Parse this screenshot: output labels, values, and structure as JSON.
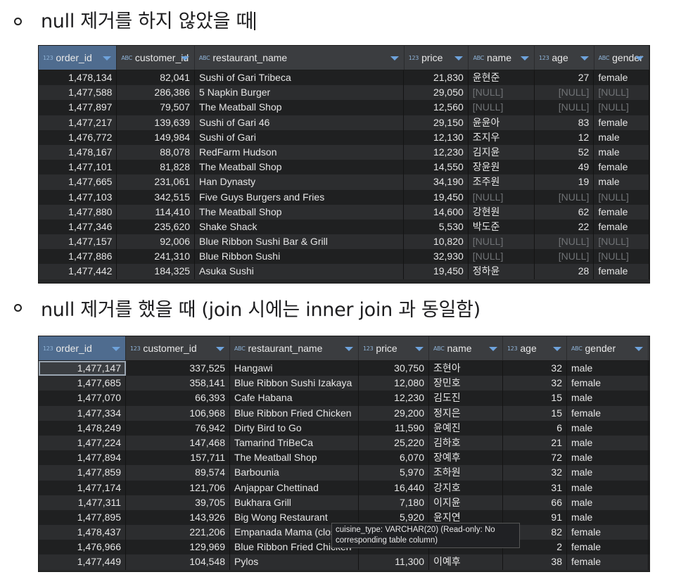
{
  "section1": {
    "text": "null 제거를 하지 않았을 때"
  },
  "section2": {
    "text": "null 제거를 했을 때 (join 시에는 inner join 과 동일함)"
  },
  "table1": {
    "columns": [
      {
        "type": "123",
        "label": "order_id"
      },
      {
        "type": "ABC",
        "label": "customer_id"
      },
      {
        "type": "ABC",
        "label": "restaurant_name"
      },
      {
        "type": "123",
        "label": "price"
      },
      {
        "type": "ABC",
        "label": "name"
      },
      {
        "type": "123",
        "label": "age"
      },
      {
        "type": "ABC",
        "label": "gender"
      }
    ],
    "rows": [
      [
        "1,478,134",
        "82,041",
        "Sushi of Gari Tribeca",
        "21,830",
        "윤현준",
        "27",
        "female"
      ],
      [
        "1,477,588",
        "286,386",
        "5 Napkin Burger",
        "29,050",
        "[NULL]",
        "[NULL]",
        "[NULL]"
      ],
      [
        "1,477,897",
        "79,507",
        "The Meatball Shop",
        "12,560",
        "[NULL]",
        "[NULL]",
        "[NULL]"
      ],
      [
        "1,477,217",
        "139,639",
        "Sushi of Gari 46",
        "29,150",
        "윤윤아",
        "83",
        "female"
      ],
      [
        "1,476,772",
        "149,984",
        "Sushi of Gari",
        "12,130",
        "조지우",
        "12",
        "male"
      ],
      [
        "1,478,167",
        "88,078",
        "RedFarm Hudson",
        "12,230",
        "김지윤",
        "52",
        "male"
      ],
      [
        "1,477,101",
        "81,828",
        "The Meatball Shop",
        "14,550",
        "장윤원",
        "49",
        "female"
      ],
      [
        "1,477,665",
        "231,061",
        "Han Dynasty",
        "34,190",
        "조주원",
        "19",
        "male"
      ],
      [
        "1,477,103",
        "342,515",
        "Five Guys Burgers and Fries",
        "19,450",
        "[NULL]",
        "[NULL]",
        "[NULL]"
      ],
      [
        "1,477,880",
        "114,410",
        "The Meatball Shop",
        "14,600",
        "강현원",
        "62",
        "female"
      ],
      [
        "1,477,346",
        "235,620",
        "Shake Shack",
        "5,530",
        "박도준",
        "22",
        "female"
      ],
      [
        "1,477,157",
        "92,006",
        "Blue Ribbon Sushi Bar & Grill",
        "10,820",
        "[NULL]",
        "[NULL]",
        "[NULL]"
      ],
      [
        "1,477,886",
        "241,310",
        "Blue Ribbon Sushi",
        "32,930",
        "[NULL]",
        "[NULL]",
        "[NULL]"
      ],
      [
        "1,477,442",
        "184,325",
        "Asuka Sushi",
        "19,450",
        "정하윤",
        "28",
        "female"
      ]
    ]
  },
  "table2": {
    "columns": [
      {
        "type": "123",
        "label": "order_id"
      },
      {
        "type": "123",
        "label": "customer_id"
      },
      {
        "type": "ABC",
        "label": "restaurant_name"
      },
      {
        "type": "123",
        "label": "price"
      },
      {
        "type": "ABC",
        "label": "name"
      },
      {
        "type": "123",
        "label": "age"
      },
      {
        "type": "ABC",
        "label": "gender"
      }
    ],
    "rows": [
      [
        "1,477,147",
        "337,525",
        "Hangawi",
        "30,750",
        "조현아",
        "32",
        "male"
      ],
      [
        "1,477,685",
        "358,141",
        "Blue Ribbon Sushi Izakaya",
        "12,080",
        "장민호",
        "32",
        "female"
      ],
      [
        "1,477,070",
        "66,393",
        "Cafe Habana",
        "12,230",
        "김도진",
        "15",
        "male"
      ],
      [
        "1,477,334",
        "106,968",
        "Blue Ribbon Fried Chicken",
        "29,200",
        "정지은",
        "15",
        "female"
      ],
      [
        "1,478,249",
        "76,942",
        "Dirty Bird to Go",
        "11,590",
        "윤예진",
        "6",
        "male"
      ],
      [
        "1,477,224",
        "147,468",
        "Tamarind TriBeCa",
        "25,220",
        "김하호",
        "21",
        "male"
      ],
      [
        "1,477,894",
        "157,711",
        "The Meatball Shop",
        "6,070",
        "장예후",
        "72",
        "male"
      ],
      [
        "1,477,859",
        "89,574",
        "Barbounia",
        "5,970",
        "조하원",
        "32",
        "male"
      ],
      [
        "1,477,174",
        "121,706",
        "Anjappar Chettinad",
        "16,440",
        "강지호",
        "31",
        "male"
      ],
      [
        "1,477,311",
        "39,705",
        "Bukhara Grill",
        "7,180",
        "이지윤",
        "66",
        "male"
      ],
      [
        "1,477,895",
        "143,926",
        "Big Wong Restaurant",
        "5,920",
        "윤지연",
        "91",
        "male"
      ],
      [
        "1,478,437",
        "221,206",
        "Empanada Mama (closed)",
        "",
        "",
        "82",
        "female"
      ],
      [
        "1,476,966",
        "129,969",
        "Blue Ribbon Fried Chicken",
        "",
        "",
        "2",
        "female"
      ],
      [
        "1,477,449",
        "104,548",
        "Pylos",
        "11,300",
        "이예후",
        "38",
        "female"
      ]
    ],
    "tooltip": "cuisine_type: VARCHAR(20) (Read-only: No corresponding table column)"
  }
}
